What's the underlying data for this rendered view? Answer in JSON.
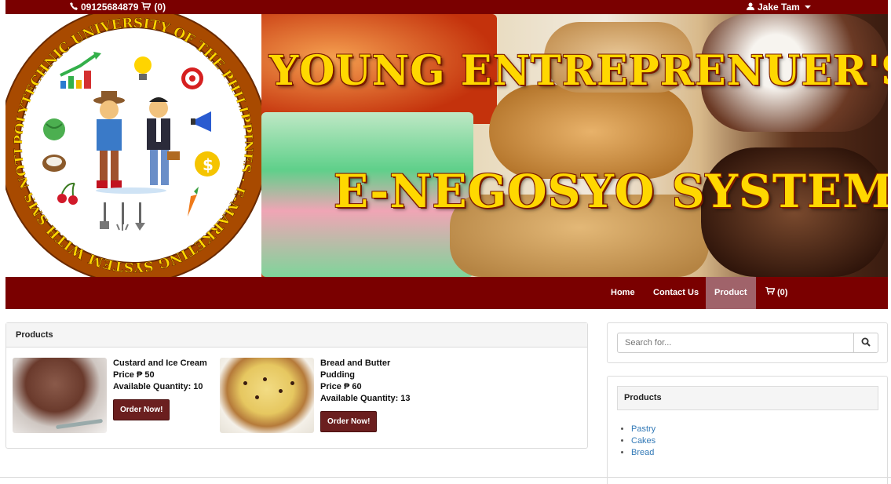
{
  "topbar": {
    "phone": "09125684879",
    "cart_count": "(0)",
    "user_name": "Jake Tam"
  },
  "banner": {
    "logo_ring_text": "POLYTECHNIC UNIVERSITY OF THE PHILIPPINES E-MARKETING SYSTEM WITH SMS NOTIFICATION",
    "title_line1": "YOUNG ENTREPRENUER'S",
    "title_line2": "E-NEGOSYO SYSTEM"
  },
  "nav": {
    "items": [
      "Home",
      "Contact Us",
      "Product"
    ],
    "active": "Product",
    "cart_label": "(0)"
  },
  "products_panel": {
    "heading": "Products",
    "items": [
      {
        "name": "Custard and Ice Cream",
        "price": "Price ₱ 50",
        "quantity": "Available Quantity: 10",
        "button": "Order Now!"
      },
      {
        "name": "Bread and Butter Pudding",
        "price": "Price ₱ 60",
        "quantity": "Available Quantity: 13",
        "button": "Order Now!"
      }
    ]
  },
  "search": {
    "placeholder": "Search for..."
  },
  "categories": {
    "heading": "Products",
    "items": [
      "Pastry",
      "Cakes",
      "Bread"
    ]
  },
  "colors": {
    "brand": "#7a0000",
    "nav_active": "#a0636a",
    "button": "#6b1f1f",
    "link": "#337ab7",
    "title": "#ffd800"
  },
  "icons": [
    "phone-icon",
    "cart-icon",
    "user-icon",
    "caret-down-icon",
    "search-icon"
  ]
}
